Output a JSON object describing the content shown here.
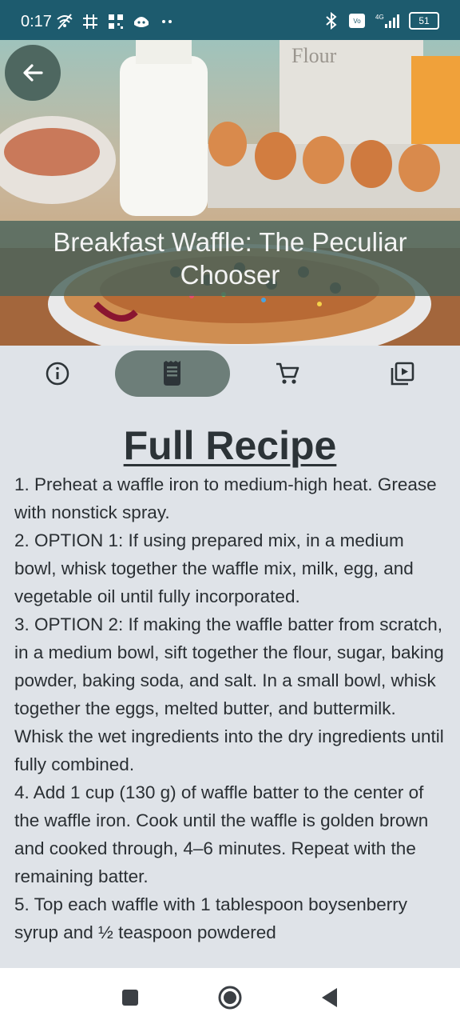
{
  "status_bar": {
    "time": "0:17",
    "left_icons": [
      "wifi-off-icon",
      "grid-icon",
      "qr-icon",
      "robot-icon",
      "more-dots-icon"
    ],
    "right_icons": [
      "bluetooth-icon",
      "volte-icon",
      "signal-icon"
    ],
    "network": "4G",
    "battery": "51"
  },
  "header": {
    "title": "Breakfast Waffle: The Peculiar Chooser",
    "back_icon": "arrow-left-icon"
  },
  "tabs": [
    {
      "name": "info",
      "icon": "info-icon",
      "active": false
    },
    {
      "name": "recipe",
      "icon": "receipt-icon",
      "active": true
    },
    {
      "name": "cart",
      "icon": "cart-icon",
      "active": false
    },
    {
      "name": "video",
      "icon": "video-library-icon",
      "active": false
    }
  ],
  "recipe": {
    "heading": "Full Recipe",
    "steps": [
      "1. Preheat a waffle iron to medium-high heat. Grease with nonstick spray.",
      "2. OPTION 1: If using prepared mix, in a medium bowl, whisk together the waffle mix, milk, egg, and vegetable oil until fully incorporated.",
      "3. OPTION 2: If making the waffle batter from scratch, in a medium bowl, sift together the flour, sugar, baking powder, baking soda, and salt.  In a small bowl, whisk together the eggs, melted butter, and buttermilk. Whisk the wet ingredients into the dry ingredients until fully combined.",
      "4. Add 1 cup (130 g) of waffle batter to the center of the waffle iron. Cook until the waffle is golden brown and cooked through, 4–6 minutes. Repeat with the remaining batter.",
      "5. Top each waffle with 1 tablespoon boysenberry syrup and ½ teaspoon powdered"
    ]
  },
  "nav": {
    "recents_icon": "square-icon",
    "home_icon": "circle-icon",
    "back_icon": "triangle-back-icon"
  },
  "colors": {
    "status_bar": "#1d5b6e",
    "background": "#dfe3e8",
    "accent": "#6d7e79",
    "title_band": "#4a645c"
  }
}
